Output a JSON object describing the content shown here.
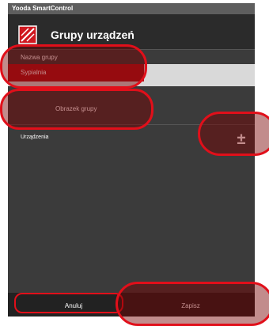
{
  "status_bar": {
    "app_name": "Yooda SmartControl"
  },
  "header": {
    "title": "Grupy urządzeń",
    "icon": "group-devices-icon"
  },
  "form": {
    "name_label": "Nazwa grupy",
    "name_value": "Sypialnia",
    "image_button_label": "Obrazek grupy",
    "devices_label": "Urządzenia",
    "add_device_symbol": "±"
  },
  "footer": {
    "cancel_label": "Anuluj",
    "save_label": "Zapisz"
  },
  "colors": {
    "background": "#3b3b3b",
    "header": "#2b2b2b",
    "accent_red": "#b0141c",
    "highlight_red": "#e10f1a",
    "field": "#d9d9d9"
  }
}
